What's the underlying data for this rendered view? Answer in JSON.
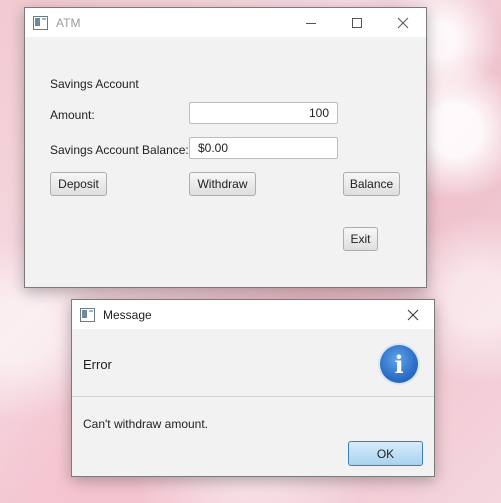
{
  "atm_window": {
    "title": "ATM",
    "section_title": "Savings Account",
    "amount_label": "Amount:",
    "amount_value": "100",
    "balance_label": "Savings Account Balance:",
    "balance_value": "$0.00",
    "buttons": {
      "deposit": "Deposit",
      "withdraw": "Withdraw",
      "balance": "Balance",
      "exit": "Exit"
    },
    "controls": {
      "minimize": "—",
      "maximize": "☐",
      "close": "✕"
    }
  },
  "message_dialog": {
    "title": "Message",
    "header": "Error",
    "icon": "info-icon",
    "info_glyph": "i",
    "message": "Can't withdraw amount.",
    "ok_label": "OK",
    "close": "✕"
  }
}
